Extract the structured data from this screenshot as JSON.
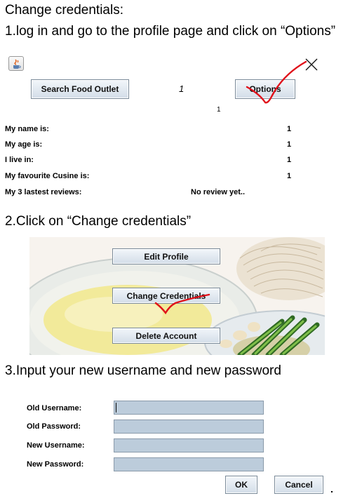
{
  "doc_title": "Change credentials:",
  "steps": {
    "step1": "1.log in and go to the profile page and click on “Options”",
    "step2": "2.Click on “Change credentials”",
    "step3": "3.Input your new username and new password"
  },
  "screen1": {
    "java_icon": "java-icon",
    "search_button": "Search Food Outlet",
    "italic_number": "1",
    "options_button": "Options",
    "small_number": "1",
    "profile": [
      {
        "label": "My name is:",
        "value": "1"
      },
      {
        "label": "My age is:",
        "value": "1"
      },
      {
        "label": "I live in:",
        "value": "1"
      },
      {
        "label": "My favourite Cusine is:",
        "value": "1"
      },
      {
        "label": "My 3 lastest reviews:",
        "value": "No review yet.."
      }
    ]
  },
  "screen2": {
    "edit_profile": "Edit Profile",
    "change_credentials": "Change Credentials",
    "delete_account": "Delete Account"
  },
  "screen3": {
    "fields": [
      {
        "label": "Old Username:",
        "value": ""
      },
      {
        "label": "Old Password:",
        "value": ""
      },
      {
        "label": "New Username:",
        "value": ""
      },
      {
        "label": "New Password:",
        "value": ""
      }
    ],
    "ok_button": "OK",
    "cancel_button": "Cancel"
  },
  "colors": {
    "annotation_red": "#e0101a",
    "field_bg": "#bcccdb"
  }
}
